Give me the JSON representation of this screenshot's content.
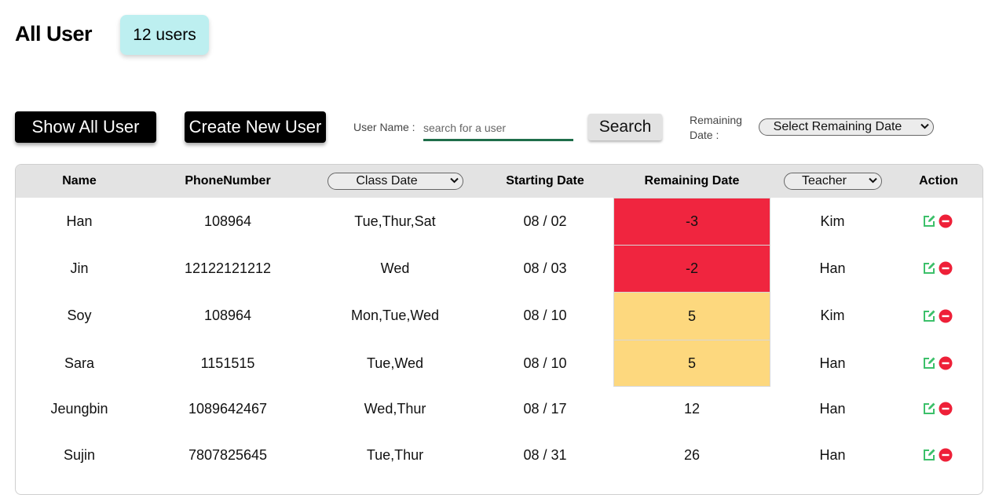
{
  "header": {
    "title": "All User",
    "count_badge": "12 users"
  },
  "toolbar": {
    "show_all_label": "Show All User",
    "create_label": "Create New User",
    "username_label": "User Name :",
    "search_placeholder": "search for a user",
    "search_label": "Search",
    "remaining_label_line1": "Remaining",
    "remaining_label_line2": "Date :",
    "remaining_select": "Select Remaining Date"
  },
  "table": {
    "headers": {
      "name": "Name",
      "phone": "PhoneNumber",
      "class_date_select": "Class Date",
      "starting_date": "Starting Date",
      "remaining_date": "Remaining Date",
      "teacher_select": "Teacher",
      "action": "Action"
    },
    "rows": [
      {
        "name": "Han",
        "phone": "108964",
        "class_date": "Tue,Thur,Sat",
        "start": "08 / 02",
        "remaining": "-3",
        "status": "overdue",
        "teacher": "Kim"
      },
      {
        "name": "Jin",
        "phone": "12122121212",
        "class_date": "Wed",
        "start": "08 / 03",
        "remaining": "-2",
        "status": "overdue",
        "teacher": "Han"
      },
      {
        "name": "Soy",
        "phone": "108964",
        "class_date": "Mon,Tue,Wed",
        "start": "08 / 10",
        "remaining": "5",
        "status": "soon",
        "teacher": "Kim"
      },
      {
        "name": "Sara",
        "phone": "1151515",
        "class_date": "Tue,Wed",
        "start": "08 / 10",
        "remaining": "5",
        "status": "soon",
        "teacher": "Han"
      },
      {
        "name": "Jeungbin",
        "phone": "1089642467",
        "class_date": "Wed,Thur",
        "start": "08 / 17",
        "remaining": "12",
        "status": "ok",
        "teacher": "Han"
      },
      {
        "name": "Sujin",
        "phone": "7807825645",
        "class_date": "Tue,Thur",
        "start": "08 / 31",
        "remaining": "26",
        "status": "ok",
        "teacher": "Han"
      }
    ]
  },
  "colors": {
    "overdue": "#f0253f",
    "soon": "#fdd87e",
    "ok": "#ffffff",
    "edit_icon": "#3cc06a",
    "delete_icon": "#ee2038",
    "badge": "#bdeff0"
  },
  "icons": {
    "edit": "edit-icon",
    "delete": "delete-icon"
  }
}
